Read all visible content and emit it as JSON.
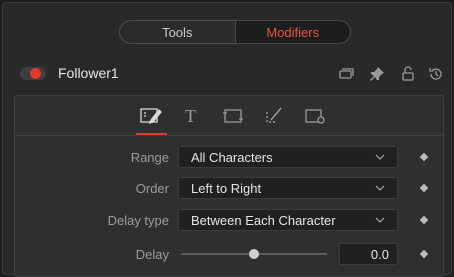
{
  "tabs": [
    {
      "label": "Tools",
      "active": false
    },
    {
      "label": "Modifiers",
      "active": true
    }
  ],
  "accent_color": "#e0392b",
  "node": {
    "name": "Follower1",
    "enabled": true,
    "header_icons": [
      "collapse-icon",
      "pin-icon",
      "lock-icon",
      "reset-icon"
    ]
  },
  "icon_bar": {
    "icons": [
      "modifier-controls-icon",
      "text-icon",
      "layout-icon",
      "shading-icon",
      "settings-icon"
    ],
    "text_glyph": "T",
    "active_index": 0
  },
  "controls": {
    "range": {
      "label": "Range",
      "value": "All Characters"
    },
    "order": {
      "label": "Order",
      "value": "Left to Right"
    },
    "delay_type": {
      "label": "Delay type",
      "value": "Between Each Character"
    },
    "delay": {
      "label": "Delay",
      "value": "0.0"
    }
  }
}
